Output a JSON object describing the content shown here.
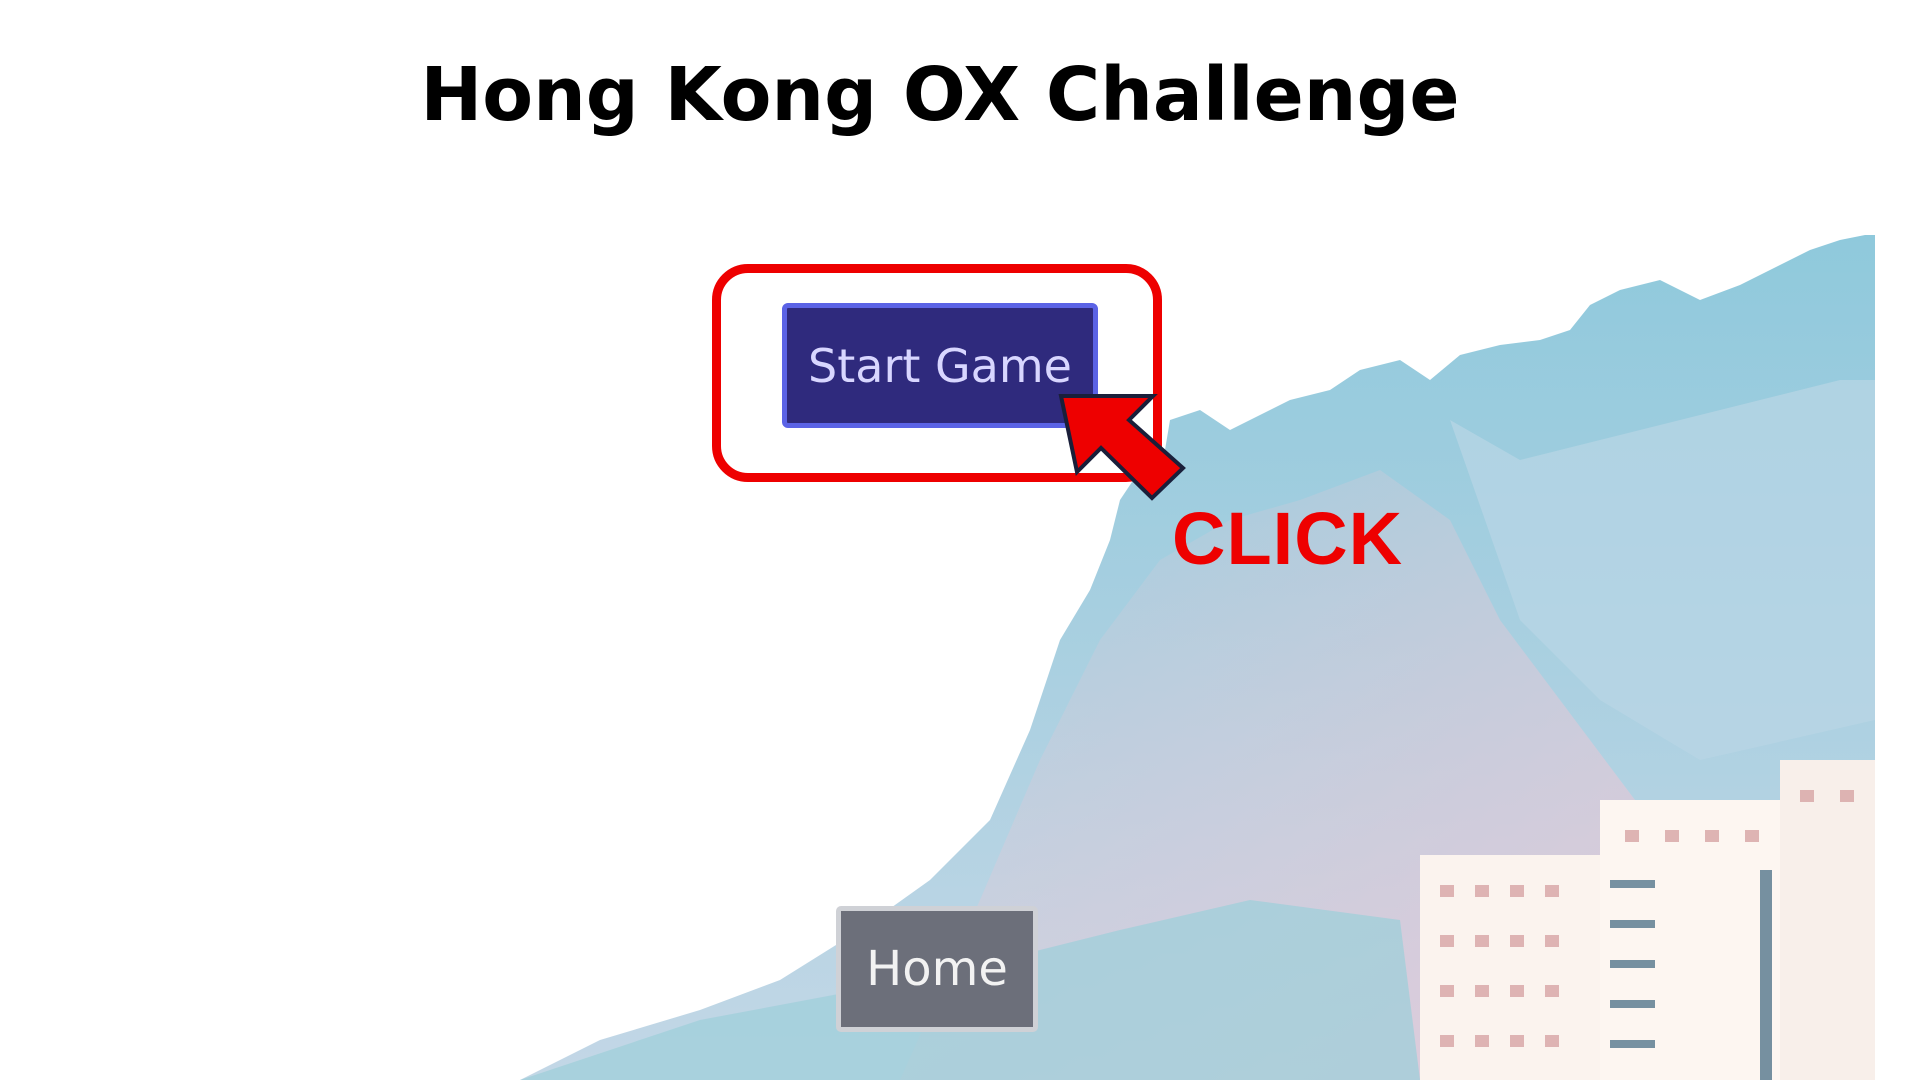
{
  "page": {
    "title": "Hong Kong OX Challenge"
  },
  "buttons": {
    "start_label": "Start Game",
    "home_label": "Home"
  },
  "annotation": {
    "click_label": "CLICK",
    "arrow_icon": "pointer-arrow-icon",
    "highlight_color": "#ee0000"
  },
  "colors": {
    "start_button_bg": "#2f2a7d",
    "start_button_border": "#5b63e6",
    "home_button_bg": "#6c6f7a"
  }
}
